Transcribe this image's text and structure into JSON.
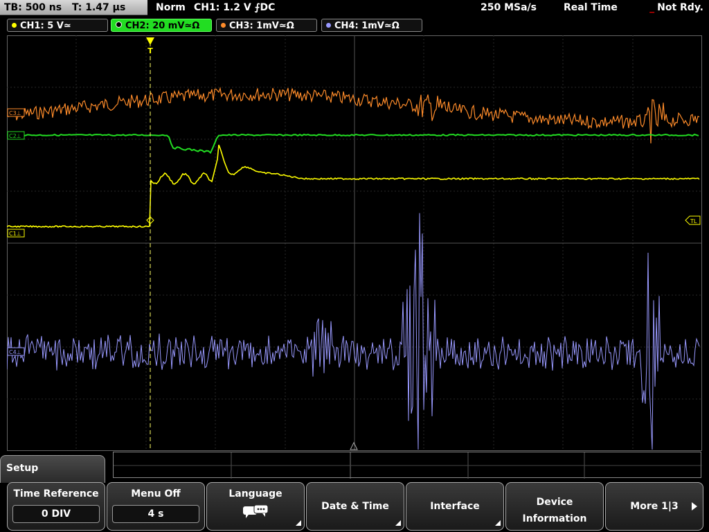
{
  "status": {
    "timebase": "TB: 500 ns",
    "trigger_time": "T: 1.47 µs",
    "trigger_mode": "Norm",
    "trigger_source": "CH1: 1.2 V ⨍DC",
    "sample_rate": "250 MSa/s",
    "acq_mode": "Real Time",
    "ready_indicator": "_",
    "ready_state": "Not Rdy."
  },
  "channels": [
    {
      "label": "CH1: 5 V≃",
      "color": "#ffff00",
      "active": false
    },
    {
      "label": "CH2: 20 mV≃Ω",
      "color": "#22dd22",
      "active": true
    },
    {
      "label": "CH3: 1mV≃Ω",
      "color": "#ff8c2a",
      "active": false
    },
    {
      "label": "CH4: 1mV≃Ω",
      "color": "#9999ff",
      "active": false
    }
  ],
  "markers": {
    "trigger_marker": "T",
    "ch3_marker": "C3⊥",
    "ch2_marker": "C2⊥",
    "ch1_marker": "C1⊥",
    "ch4_marker": "C4⊥",
    "trigger_level": "TL"
  },
  "menu": {
    "title": "Setup",
    "softkeys": [
      {
        "label": "Time Reference",
        "value": "0 DIV"
      },
      {
        "label": "Menu Off",
        "value": "4 s"
      },
      {
        "label": "Language",
        "icon": "speech-bubbles-icon"
      },
      {
        "label": "Date & Time"
      },
      {
        "label": "Interface"
      },
      {
        "label_line1": "Device",
        "label_line2": "Information"
      },
      {
        "label": "More 1|3"
      }
    ]
  }
}
